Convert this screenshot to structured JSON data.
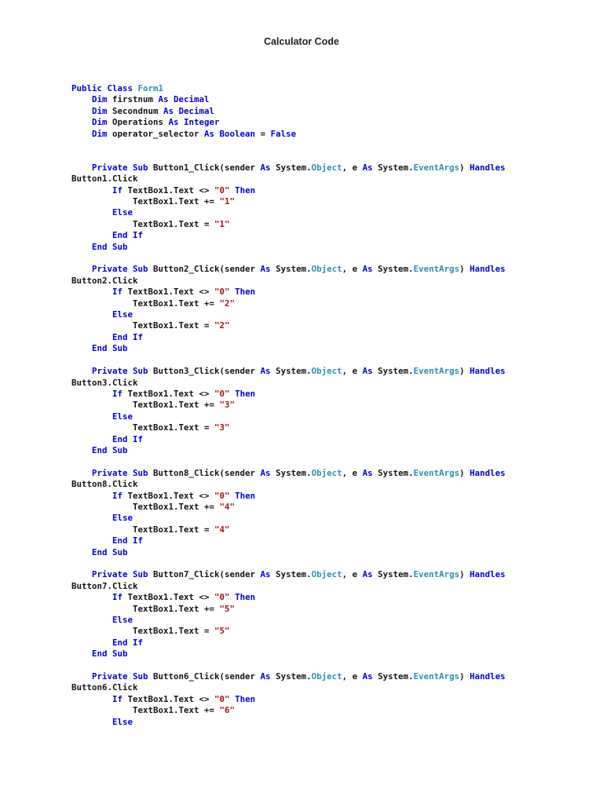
{
  "page": {
    "title": "Calculator Code"
  },
  "code": {
    "language": "vb.net",
    "token_colors": {
      "keyword": "#0000dc",
      "type": "#2b91af",
      "string": "#a31515",
      "plain": "#141414"
    },
    "lines": [
      [
        [
          "k",
          "Public Class "
        ],
        [
          "t",
          "Form1"
        ]
      ],
      [
        [
          "p",
          "    "
        ],
        [
          "k",
          "Dim"
        ],
        [
          "p",
          " firstnum "
        ],
        [
          "k",
          "As Decimal"
        ]
      ],
      [
        [
          "p",
          "    "
        ],
        [
          "k",
          "Dim"
        ],
        [
          "p",
          " Secondnum "
        ],
        [
          "k",
          "As Decimal"
        ]
      ],
      [
        [
          "p",
          "    "
        ],
        [
          "k",
          "Dim"
        ],
        [
          "p",
          " Operations "
        ],
        [
          "k",
          "As Integer"
        ]
      ],
      [
        [
          "p",
          "    "
        ],
        [
          "k",
          "Dim"
        ],
        [
          "p",
          " operator_selector "
        ],
        [
          "k",
          "As Boolean"
        ],
        [
          "p",
          " = "
        ],
        [
          "k",
          "False"
        ]
      ],
      [],
      [],
      [
        [
          "p",
          "    "
        ],
        [
          "k",
          "Private Sub"
        ],
        [
          "p",
          " Button1_Click(sender "
        ],
        [
          "k",
          "As"
        ],
        [
          "p",
          " System."
        ],
        [
          "t",
          "Object"
        ],
        [
          "p",
          ", e "
        ],
        [
          "k",
          "As"
        ],
        [
          "p",
          " System."
        ],
        [
          "t",
          "EventArgs"
        ],
        [
          "p",
          ") "
        ],
        [
          "k",
          "Handles"
        ]
      ],
      [
        [
          "p",
          "Button1.Click"
        ]
      ],
      [
        [
          "p",
          "        "
        ],
        [
          "k",
          "If"
        ],
        [
          "p",
          " TextBox1.Text <> "
        ],
        [
          "s",
          "\"0\""
        ],
        [
          "p",
          " "
        ],
        [
          "k",
          "Then"
        ]
      ],
      [
        [
          "p",
          "            TextBox1.Text += "
        ],
        [
          "s",
          "\"1\""
        ]
      ],
      [
        [
          "p",
          "        "
        ],
        [
          "k",
          "Else"
        ]
      ],
      [
        [
          "p",
          "            TextBox1.Text = "
        ],
        [
          "s",
          "\"1\""
        ]
      ],
      [
        [
          "p",
          "        "
        ],
        [
          "k",
          "End If"
        ]
      ],
      [
        [
          "p",
          "    "
        ],
        [
          "k",
          "End Sub"
        ]
      ],
      [],
      [
        [
          "p",
          "    "
        ],
        [
          "k",
          "Private Sub"
        ],
        [
          "p",
          " Button2_Click(sender "
        ],
        [
          "k",
          "As"
        ],
        [
          "p",
          " System."
        ],
        [
          "t",
          "Object"
        ],
        [
          "p",
          ", e "
        ],
        [
          "k",
          "As"
        ],
        [
          "p",
          " System."
        ],
        [
          "t",
          "EventArgs"
        ],
        [
          "p",
          ") "
        ],
        [
          "k",
          "Handles"
        ]
      ],
      [
        [
          "p",
          "Button2.Click"
        ]
      ],
      [
        [
          "p",
          "        "
        ],
        [
          "k",
          "If"
        ],
        [
          "p",
          " TextBox1.Text <> "
        ],
        [
          "s",
          "\"0\""
        ],
        [
          "p",
          " "
        ],
        [
          "k",
          "Then"
        ]
      ],
      [
        [
          "p",
          "            TextBox1.Text += "
        ],
        [
          "s",
          "\"2\""
        ]
      ],
      [
        [
          "p",
          "        "
        ],
        [
          "k",
          "Else"
        ]
      ],
      [
        [
          "p",
          "            TextBox1.Text = "
        ],
        [
          "s",
          "\"2\""
        ]
      ],
      [
        [
          "p",
          "        "
        ],
        [
          "k",
          "End If"
        ]
      ],
      [
        [
          "p",
          "    "
        ],
        [
          "k",
          "End Sub"
        ]
      ],
      [],
      [
        [
          "p",
          "    "
        ],
        [
          "k",
          "Private Sub"
        ],
        [
          "p",
          " Button3_Click(sender "
        ],
        [
          "k",
          "As"
        ],
        [
          "p",
          " System."
        ],
        [
          "t",
          "Object"
        ],
        [
          "p",
          ", e "
        ],
        [
          "k",
          "As"
        ],
        [
          "p",
          " System."
        ],
        [
          "t",
          "EventArgs"
        ],
        [
          "p",
          ") "
        ],
        [
          "k",
          "Handles"
        ]
      ],
      [
        [
          "p",
          "Button3.Click"
        ]
      ],
      [
        [
          "p",
          "        "
        ],
        [
          "k",
          "If"
        ],
        [
          "p",
          " TextBox1.Text <> "
        ],
        [
          "s",
          "\"0\""
        ],
        [
          "p",
          " "
        ],
        [
          "k",
          "Then"
        ]
      ],
      [
        [
          "p",
          "            TextBox1.Text += "
        ],
        [
          "s",
          "\"3\""
        ]
      ],
      [
        [
          "p",
          "        "
        ],
        [
          "k",
          "Else"
        ]
      ],
      [
        [
          "p",
          "            TextBox1.Text = "
        ],
        [
          "s",
          "\"3\""
        ]
      ],
      [
        [
          "p",
          "        "
        ],
        [
          "k",
          "End If"
        ]
      ],
      [
        [
          "p",
          "    "
        ],
        [
          "k",
          "End Sub"
        ]
      ],
      [],
      [
        [
          "p",
          "    "
        ],
        [
          "k",
          "Private Sub"
        ],
        [
          "p",
          " Button8_Click(sender "
        ],
        [
          "k",
          "As"
        ],
        [
          "p",
          " System."
        ],
        [
          "t",
          "Object"
        ],
        [
          "p",
          ", e "
        ],
        [
          "k",
          "As"
        ],
        [
          "p",
          " System."
        ],
        [
          "t",
          "EventArgs"
        ],
        [
          "p",
          ") "
        ],
        [
          "k",
          "Handles"
        ]
      ],
      [
        [
          "p",
          "Button8.Click"
        ]
      ],
      [
        [
          "p",
          "        "
        ],
        [
          "k",
          "If"
        ],
        [
          "p",
          " TextBox1.Text <> "
        ],
        [
          "s",
          "\"0\""
        ],
        [
          "p",
          " "
        ],
        [
          "k",
          "Then"
        ]
      ],
      [
        [
          "p",
          "            TextBox1.Text += "
        ],
        [
          "s",
          "\"4\""
        ]
      ],
      [
        [
          "p",
          "        "
        ],
        [
          "k",
          "Else"
        ]
      ],
      [
        [
          "p",
          "            TextBox1.Text = "
        ],
        [
          "s",
          "\"4\""
        ]
      ],
      [
        [
          "p",
          "        "
        ],
        [
          "k",
          "End If"
        ]
      ],
      [
        [
          "p",
          "    "
        ],
        [
          "k",
          "End Sub"
        ]
      ],
      [],
      [
        [
          "p",
          "    "
        ],
        [
          "k",
          "Private Sub"
        ],
        [
          "p",
          " Button7_Click(sender "
        ],
        [
          "k",
          "As"
        ],
        [
          "p",
          " System."
        ],
        [
          "t",
          "Object"
        ],
        [
          "p",
          ", e "
        ],
        [
          "k",
          "As"
        ],
        [
          "p",
          " System."
        ],
        [
          "t",
          "EventArgs"
        ],
        [
          "p",
          ") "
        ],
        [
          "k",
          "Handles"
        ]
      ],
      [
        [
          "p",
          "Button7.Click"
        ]
      ],
      [
        [
          "p",
          "        "
        ],
        [
          "k",
          "If"
        ],
        [
          "p",
          " TextBox1.Text <> "
        ],
        [
          "s",
          "\"0\""
        ],
        [
          "p",
          " "
        ],
        [
          "k",
          "Then"
        ]
      ],
      [
        [
          "p",
          "            TextBox1.Text += "
        ],
        [
          "s",
          "\"5\""
        ]
      ],
      [
        [
          "p",
          "        "
        ],
        [
          "k",
          "Else"
        ]
      ],
      [
        [
          "p",
          "            TextBox1.Text = "
        ],
        [
          "s",
          "\"5\""
        ]
      ],
      [
        [
          "p",
          "        "
        ],
        [
          "k",
          "End If"
        ]
      ],
      [
        [
          "p",
          "    "
        ],
        [
          "k",
          "End Sub"
        ]
      ],
      [],
      [
        [
          "p",
          "    "
        ],
        [
          "k",
          "Private Sub"
        ],
        [
          "p",
          " Button6_Click(sender "
        ],
        [
          "k",
          "As"
        ],
        [
          "p",
          " System."
        ],
        [
          "t",
          "Object"
        ],
        [
          "p",
          ", e "
        ],
        [
          "k",
          "As"
        ],
        [
          "p",
          " System."
        ],
        [
          "t",
          "EventArgs"
        ],
        [
          "p",
          ") "
        ],
        [
          "k",
          "Handles"
        ]
      ],
      [
        [
          "p",
          "Button6.Click"
        ]
      ],
      [
        [
          "p",
          "        "
        ],
        [
          "k",
          "If"
        ],
        [
          "p",
          " TextBox1.Text <> "
        ],
        [
          "s",
          "\"0\""
        ],
        [
          "p",
          " "
        ],
        [
          "k",
          "Then"
        ]
      ],
      [
        [
          "p",
          "            TextBox1.Text += "
        ],
        [
          "s",
          "\"6\""
        ]
      ],
      [
        [
          "p",
          "        "
        ],
        [
          "k",
          "Else"
        ]
      ]
    ]
  }
}
